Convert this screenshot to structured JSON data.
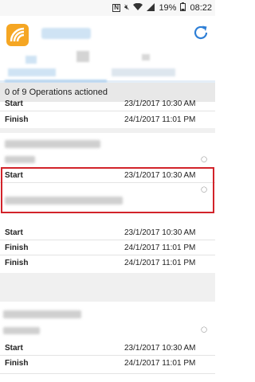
{
  "status_bar": {
    "battery": "19%",
    "time": "08:22",
    "icons": [
      "nfc-icon",
      "mute-icon",
      "wifi-icon",
      "signal-icon",
      "battery-icon"
    ]
  },
  "app_bar": {
    "icons": [
      "app-logo",
      "refresh-icon"
    ],
    "colors": {
      "logo": "#f5a623",
      "refresh": "#2e7fd6"
    }
  },
  "summary": {
    "text": "0 of 9 Operations actioned"
  },
  "operations": {
    "labels": {
      "start": "Start",
      "finish": "Finish"
    },
    "items": [
      {
        "start": "23/1/2017 10:30 AM",
        "finish": "24/1/2017 11:01 PM"
      },
      {
        "start": "23/1/2017 10:30 AM",
        "finish": "24/1/2017 11:01 PM"
      },
      {
        "start": "23/1/2017 10:30 AM",
        "finish": "24/1/2017 11:01 PM"
      },
      {
        "start": "23/1/2017 10:30 AM",
        "finish": "24/1/2017 11:01 PM"
      }
    ]
  },
  "highlight_color": "#d2232a"
}
